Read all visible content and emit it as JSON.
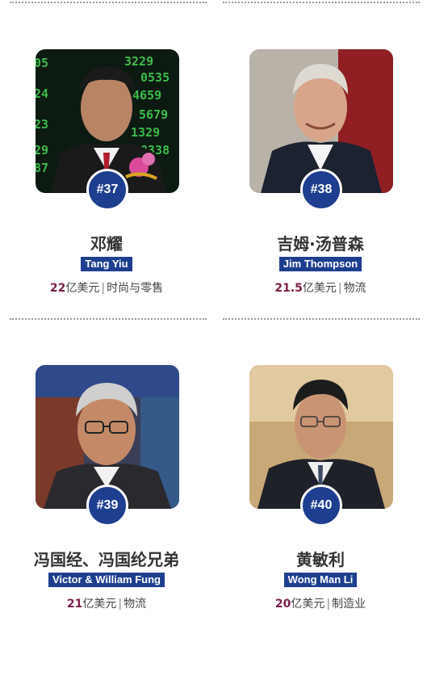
{
  "entries": [
    {
      "rank": "#37",
      "name_cn": "邓耀",
      "name_en": "Tang Yiu",
      "worth_num": "22",
      "worth_unit": "亿美元",
      "separator": "|",
      "industry": "时尚与零售"
    },
    {
      "rank": "#38",
      "name_cn": "吉姆·汤普森",
      "name_en": "Jim Thompson",
      "worth_num": "21.5",
      "worth_unit": "亿美元",
      "separator": "|",
      "industry": "物流"
    },
    {
      "rank": "#39",
      "name_cn": "冯国经、冯国纶兄弟",
      "name_en": "Victor & William Fung",
      "worth_num": "21",
      "worth_unit": "亿美元",
      "separator": "|",
      "industry": "物流"
    },
    {
      "rank": "#40",
      "name_cn": "黄敏利",
      "name_en": "Wong Man Li",
      "worth_num": "20",
      "worth_unit": "亿美元",
      "separator": "|",
      "industry": "制造业"
    }
  ],
  "colors": {
    "rank_badge": "#1e3f8f",
    "name_label_bg": "#1e3f8f",
    "worth_number": "#7a1f4a",
    "divider": "#9a9a9a"
  }
}
